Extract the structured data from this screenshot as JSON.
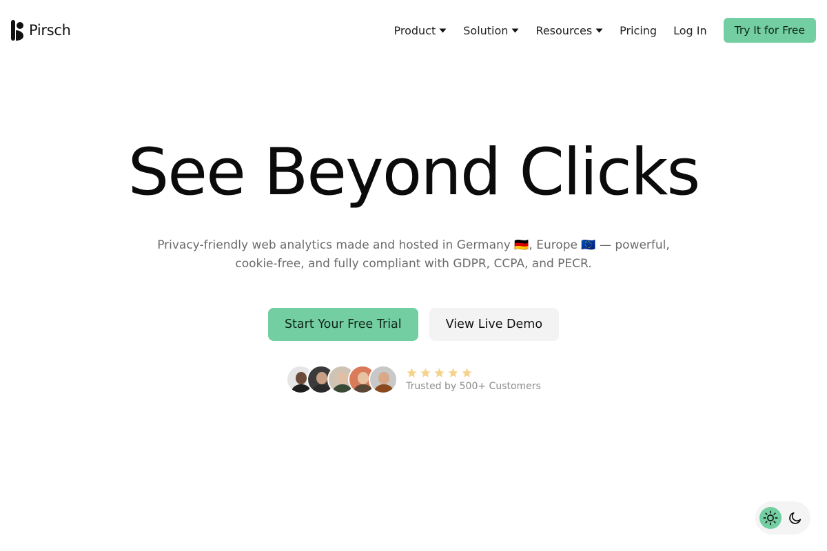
{
  "brand": {
    "name": "Pirsch",
    "accent": "#73cfa2"
  },
  "nav": {
    "items": [
      {
        "label": "Product",
        "dropdown": true
      },
      {
        "label": "Solution",
        "dropdown": true
      },
      {
        "label": "Resources",
        "dropdown": true
      },
      {
        "label": "Pricing",
        "dropdown": false
      },
      {
        "label": "Log In",
        "dropdown": false
      }
    ],
    "cta_label": "Try It for Free"
  },
  "hero": {
    "title": "See Beyond Clicks",
    "subtitle": "Privacy-friendly web analytics made and hosted in Germany 🇩🇪, Europe 🇪🇺 — powerful, cookie-free, and fully compliant with GDPR, CCPA, and PECR.",
    "primary_button": "Start Your Free Trial",
    "secondary_button": "View Live Demo"
  },
  "trust": {
    "rating_stars": 5,
    "label": "Trusted by 500+ Customers"
  },
  "theme": {
    "current": "light"
  }
}
